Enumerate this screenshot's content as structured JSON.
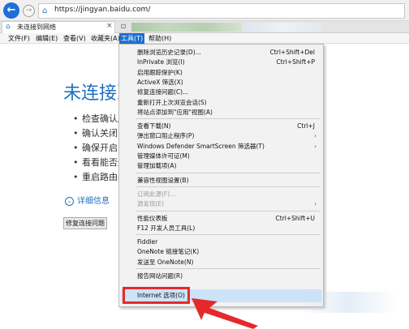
{
  "browser": {
    "url": "https://jingyan.baidu.com/",
    "tab_label": "未连接到网络",
    "tab_close": "×"
  },
  "menubar": {
    "items": [
      "文件(F)",
      "编辑(E)",
      "查看(V)",
      "收藏夹(A)",
      "工具(T)",
      "帮助(H)"
    ]
  },
  "error_page": {
    "title": "未连接到",
    "tips": [
      "检查确认所",
      "确认关闭了",
      "确保开启了",
      "看看能否连",
      "重启路由器"
    ],
    "details_label": "详细信息",
    "fix_button": "修复连接问题"
  },
  "tools_menu": {
    "groups": [
      [
        {
          "label": "删除浏览历史记录(D)...",
          "shortcut": "Ctrl+Shift+Del"
        },
        {
          "label": "InPrivate 浏览(I)",
          "shortcut": "Ctrl+Shift+P"
        },
        {
          "label": "启用跟踪保护(K)",
          "shortcut": ""
        },
        {
          "label": "ActiveX 筛选(X)",
          "shortcut": ""
        },
        {
          "label": "修复连接问题(C)...",
          "shortcut": ""
        },
        {
          "label": "重新打开上次浏览会话(S)",
          "shortcut": ""
        },
        {
          "label": "将站点添加到\"应用\"视图(A)",
          "shortcut": ""
        }
      ],
      [
        {
          "label": "查看下载(N)",
          "shortcut": "Ctrl+J"
        },
        {
          "label": "弹出窗口阻止程序(P)",
          "shortcut": "",
          "submenu": true
        },
        {
          "label": "Windows Defender SmartScreen 筛选器(T)",
          "shortcut": "",
          "submenu": true
        },
        {
          "label": "管理媒体许可证(M)",
          "shortcut": ""
        },
        {
          "label": "管理加载项(A)",
          "shortcut": ""
        }
      ],
      [
        {
          "label": "兼容性视图设置(B)",
          "shortcut": ""
        }
      ],
      [
        {
          "label": "订阅此源(F)...",
          "shortcut": "",
          "disabled": true
        },
        {
          "label": "源发现(E)",
          "shortcut": "",
          "disabled": true,
          "submenu": true
        }
      ],
      [
        {
          "label": "性能仪表板",
          "shortcut": "Ctrl+Shift+U"
        },
        {
          "label": "F12 开发人员工具(L)",
          "shortcut": ""
        }
      ],
      [
        {
          "label": "Fiddler",
          "shortcut": ""
        },
        {
          "label": "OneNote 链接笔记(K)",
          "shortcut": ""
        },
        {
          "label": "发送至 OneNote(N)",
          "shortcut": ""
        }
      ],
      [
        {
          "label": "报告网站问题(R)",
          "shortcut": ""
        },
        {
          "label": "Internet 选项(O)",
          "shortcut": "",
          "highlighted": true
        }
      ]
    ],
    "submenu_arrow": "›"
  },
  "colors": {
    "accent": "#1c6fd1",
    "error_title": "#1f6fbf",
    "annotation_red": "#e5292b",
    "highlight": "#cde3f8"
  },
  "icons": {
    "back": "arrow-left-icon",
    "forward": "arrow-right-icon",
    "favicon": "ie-page-icon",
    "details": "chevron-down-circle-icon"
  }
}
